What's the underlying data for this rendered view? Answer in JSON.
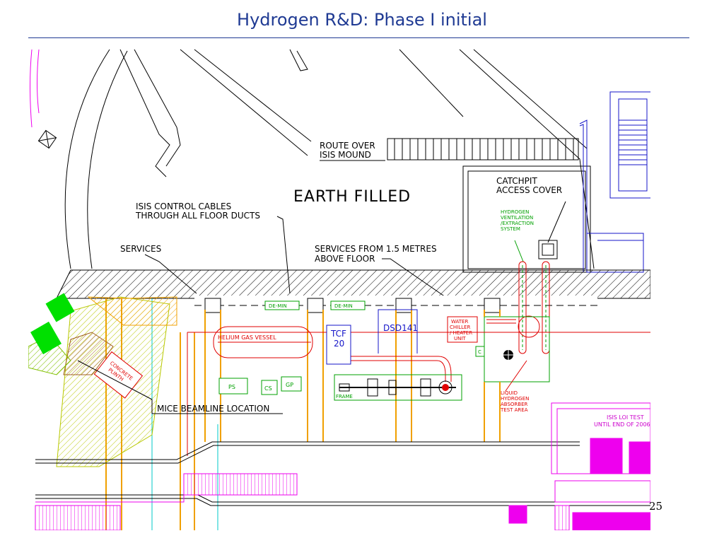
{
  "slide": {
    "title": "Hydrogen R&D: Phase I initial",
    "page_number": "25"
  },
  "drawing": {
    "labels": {
      "route_over_line1": "ROUTE OVER",
      "route_over_line2": "ISIS MOUND",
      "earth_filled": "EARTH FILLED",
      "catchpit_line1": "CATCHPIT",
      "catchpit_line2": "ACCESS COVER",
      "isis_cables_line1": "ISIS CONTROL CABLES",
      "isis_cables_line2": "THROUGH ALL FLOOR DUCTS",
      "services": "SERVICES",
      "services_from_line1": "SERVICES FROM 1.5 METRES",
      "services_from_line2": "ABOVE FLOOR",
      "hydrogen_vent_line1": "HYDROGEN",
      "hydrogen_vent_line2": "VENTILATION",
      "hydrogen_vent_line3": "/EXTRACTION",
      "hydrogen_vent_line4": "SYSTEM",
      "demin_1": "DE-MIN",
      "demin_2": "DE-MIN",
      "helium_vessel": "HELIUM GAS VESSEL",
      "tcf_line1": "TCF",
      "tcf_line2": "20",
      "dsd": "DSD141",
      "water_chiller_line1": "WATER",
      "water_chiller_line2": "CHILLER",
      "water_chiller_line3": "/ HEATER",
      "water_chiller_line4": "UNIT",
      "c_box": "C",
      "ps": "PS",
      "cs": "CS",
      "gp": "GP",
      "frame": "FRAME",
      "concrete_line1": "CONCRETE",
      "concrete_line2": "PLINTH",
      "mice_beamline": "MICE BEAMLINE LOCATION",
      "liquid_h_line1": "LIQUID",
      "liquid_h_line2": "HYDROGEN",
      "liquid_h_line3": "ABSORBER",
      "liquid_h_line4": "TEST AREA",
      "isis_loi_line1": "ISIS LOI TEST",
      "isis_loi_line2": "UNTIL END OF 2006"
    },
    "colors": {
      "cad_black": "#000000",
      "blue": "#1414c8",
      "red": "#e00000",
      "green": "#00a000",
      "orange": "#f0a000",
      "cyan": "#00c8c8",
      "magenta": "#ee00ee",
      "bright_green": "#00e000",
      "yellow_green": "#b8c800",
      "brown": "#a06020"
    }
  }
}
